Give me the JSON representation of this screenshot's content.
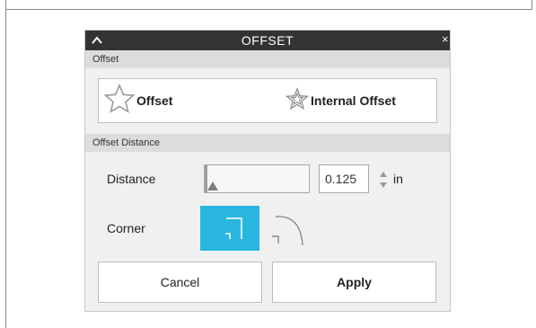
{
  "panel": {
    "title": "OFFSET",
    "collapse_icon": "chevron-up-icon",
    "close_label": "×"
  },
  "offset_section": {
    "header": "Offset",
    "options": [
      {
        "label": "Offset",
        "icon": "star-outline-icon"
      },
      {
        "label": "Internal Offset",
        "icon": "star-internal-icon"
      }
    ]
  },
  "distance_section": {
    "header": "Offset Distance",
    "distance_label": "Distance",
    "distance_value": "0.125",
    "slider_fraction": 0.0,
    "unit": "in",
    "corner_label": "Corner",
    "corner_options": [
      "sharp-corner-icon",
      "round-corner-icon"
    ],
    "selected_corner": "sharp",
    "accent_color": "#29b6de"
  },
  "actions": {
    "cancel_label": "Cancel",
    "apply_label": "Apply"
  }
}
